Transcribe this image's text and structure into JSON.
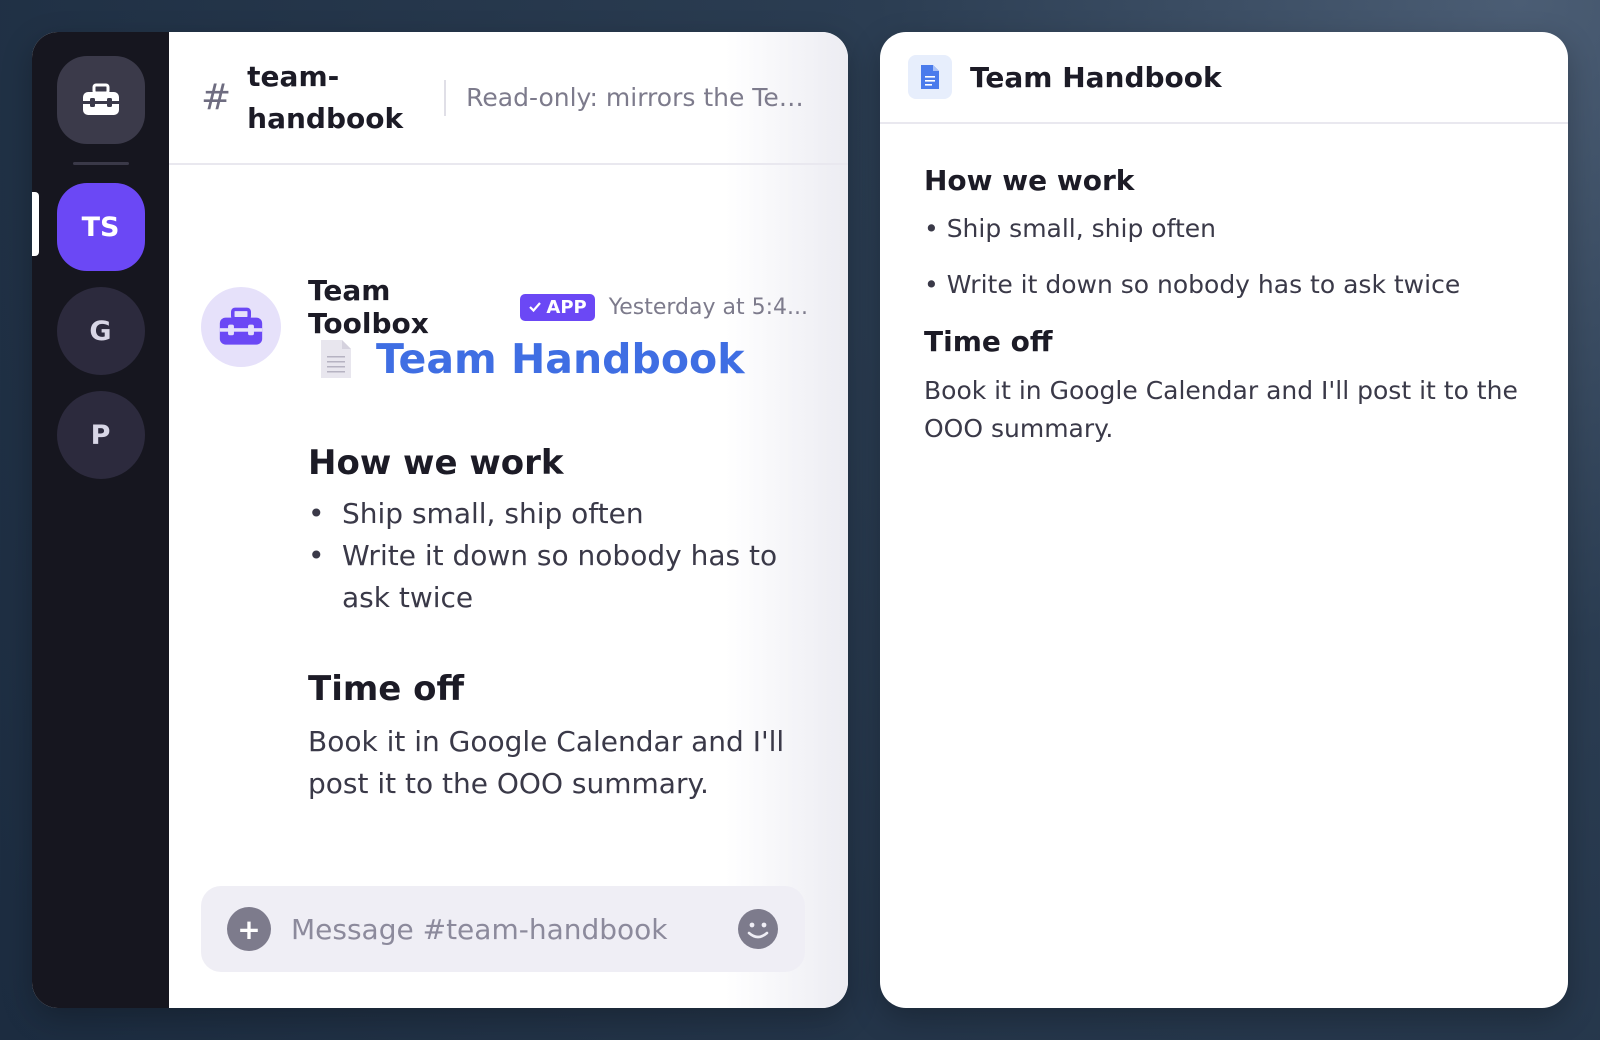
{
  "rail": {
    "home_icon": "toolbox-icon",
    "servers": [
      {
        "label": "TS",
        "active": true
      },
      {
        "label": "G",
        "active": false
      },
      {
        "label": "P",
        "active": false
      }
    ]
  },
  "channel": {
    "hash": "#",
    "name": "team-handbook",
    "topic": "Read-only: mirrors the Tea..."
  },
  "message": {
    "author": "Team Toolbox",
    "badge": "APP",
    "time": "Yesterday at 5:4...",
    "doc_link": "Team Handbook",
    "section1_heading": "How we work",
    "section1_items": [
      "Ship small, ship often",
      "Write it down so nobody has to ask twice"
    ],
    "bullet": "•",
    "section2_heading": "Time off",
    "section2_text": "Book it in Google Calendar and I'll post it to the OOO summary."
  },
  "composer": {
    "plus": "+",
    "placeholder": "Message #team-handbook"
  },
  "doc": {
    "title": "Team Handbook",
    "section1_heading": "How we work",
    "section1_items": [
      "• Ship small, ship often",
      "• Write it down so nobody has to ask twice"
    ],
    "section2_heading": "Time off",
    "section2_text": "Book it in Google Calendar and I'll post it to the OOO summary."
  },
  "colors": {
    "accent": "#6b48f5",
    "link": "#3f6ee3",
    "rail_bg": "#16161f"
  }
}
